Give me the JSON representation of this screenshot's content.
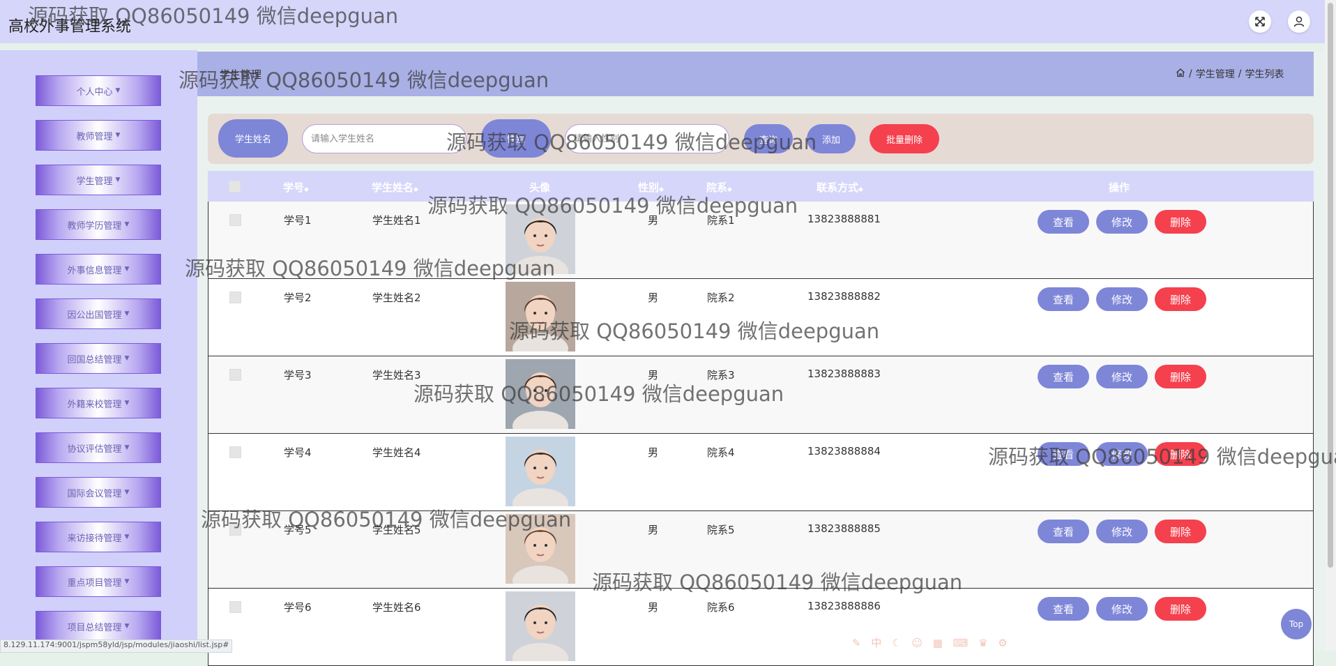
{
  "app": {
    "title": "高校外事管理系统"
  },
  "colors": {
    "accent": "#7e86d8",
    "danger": "#f5404e",
    "sidebar": "#d0d0fb",
    "topbar": "#d6d6fb",
    "header_band": "#a9b0e6"
  },
  "topbar": {
    "icons": [
      "fullscreen-icon",
      "user-icon"
    ]
  },
  "sidebar": {
    "items": [
      {
        "label": "个人中心"
      },
      {
        "label": "教师管理"
      },
      {
        "label": "学生管理"
      },
      {
        "label": "教师学历管理"
      },
      {
        "label": "外事信息管理"
      },
      {
        "label": "因公出国管理"
      },
      {
        "label": "回国总结管理"
      },
      {
        "label": "外籍来校管理"
      },
      {
        "label": "协议评估管理"
      },
      {
        "label": "国际会议管理"
      },
      {
        "label": "来访接待管理"
      },
      {
        "label": "重点项目管理"
      },
      {
        "label": "项目总结管理"
      }
    ]
  },
  "header": {
    "page_title": "学生管理",
    "breadcrumb": [
      "学生管理",
      "学生列表"
    ]
  },
  "search": {
    "name_label": "学生姓名",
    "name_placeholder": "请输入学生姓名",
    "gender_label": "性别",
    "gender_placeholder": "请输入性别",
    "search_label": "查询",
    "add_label": "添加",
    "batch_delete_label": "批量删除"
  },
  "table": {
    "headers": {
      "student_no": "学号",
      "name": "学生姓名",
      "avatar": "头像",
      "gender": "性别",
      "department": "院系",
      "phone": "联系方式",
      "actions": "操作"
    },
    "sort_icon": "◆",
    "actions": {
      "view": "查看",
      "edit": "修改",
      "delete": "删除"
    },
    "rows": [
      {
        "student_no": "学号1",
        "name": "学生姓名1",
        "gender": "男",
        "department": "院系1",
        "phone": "13823888881",
        "avatar": "avatar-photo-1"
      },
      {
        "student_no": "学号2",
        "name": "学生姓名2",
        "gender": "男",
        "department": "院系2",
        "phone": "13823888882",
        "avatar": "avatar-photo-2"
      },
      {
        "student_no": "学号3",
        "name": "学生姓名3",
        "gender": "男",
        "department": "院系3",
        "phone": "13823888883",
        "avatar": "avatar-photo-3"
      },
      {
        "student_no": "学号4",
        "name": "学生姓名4",
        "gender": "男",
        "department": "院系4",
        "phone": "13823888884",
        "avatar": "avatar-photo-4"
      },
      {
        "student_no": "学号5",
        "name": "学生姓名5",
        "gender": "男",
        "department": "院系5",
        "phone": "13823888885",
        "avatar": "avatar-photo-5"
      },
      {
        "student_no": "学号6",
        "name": "学生姓名6",
        "gender": "男",
        "department": "院系6",
        "phone": "13823888886",
        "avatar": "avatar-photo-6"
      }
    ]
  },
  "status_bar": {
    "url": "8.129.11.174:9001/jspm58yld/jsp/modules/jiaoshi/list.jsp#"
  },
  "back_to_top": {
    "label": "Top"
  },
  "watermark": {
    "text": "源码获取 QQ86050149 微信deepguan"
  }
}
